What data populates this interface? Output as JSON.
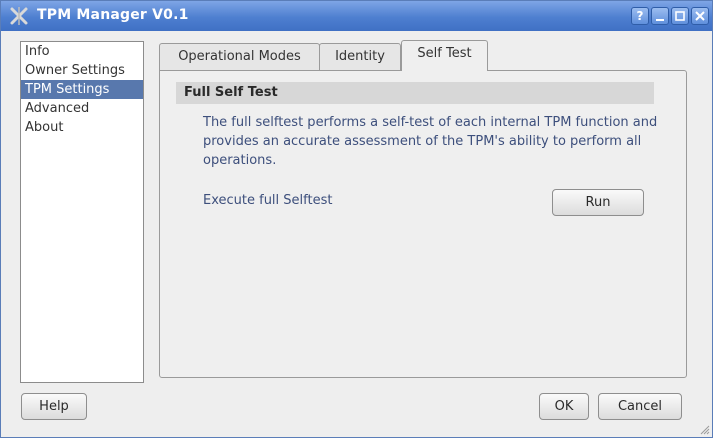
{
  "window": {
    "title": "TPM Manager V0.1"
  },
  "titlebar_buttons": {
    "help": "?",
    "minimize": "_",
    "maximize": "□",
    "close": "✕"
  },
  "sidebar": {
    "items": [
      {
        "label": "Info"
      },
      {
        "label": "Owner Settings"
      },
      {
        "label": "TPM Settings",
        "selected": true
      },
      {
        "label": "Advanced"
      },
      {
        "label": "About"
      }
    ]
  },
  "tabs": [
    {
      "label": "Operational Modes",
      "mnemonic": "M"
    },
    {
      "label": "Identity",
      "mnemonic": "I"
    },
    {
      "label": "Self Test",
      "mnemonic": "S",
      "active": true
    }
  ],
  "panel": {
    "section_title": "Full Self Test",
    "description": "The full selftest performs a self-test of each internal TPM function and provides an accurate assessment of the TPM's ability to perform all operations.",
    "execute_label": "Execute full Selftest",
    "run_button": "Run"
  },
  "footer": {
    "help_button": "Help",
    "ok_button": "OK",
    "cancel_button": "Cancel"
  },
  "colors": {
    "titlebar": "#4e7fd0",
    "selection": "#5878ad",
    "text_blue": "#3d4f7c"
  }
}
